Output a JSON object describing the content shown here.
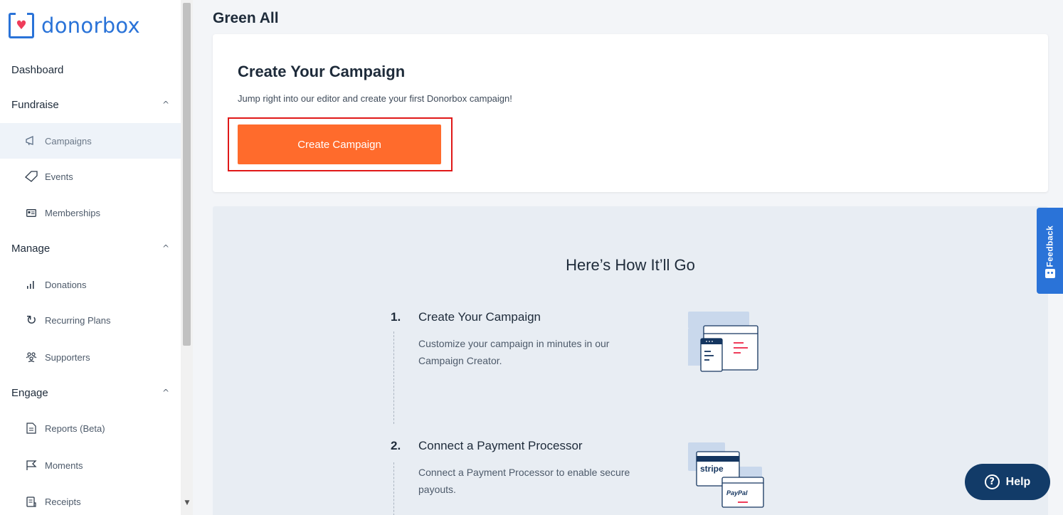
{
  "brand": {
    "name": "donorbox",
    "primary": "#2a73d8",
    "heart": "#ef3c5a"
  },
  "sidebar": {
    "dashboard": "Dashboard",
    "sections": [
      {
        "label": "Fundraise",
        "chevron": "chevron-up-icon"
      },
      {
        "label": "Manage",
        "chevron": "chevron-up-icon"
      },
      {
        "label": "Engage",
        "chevron": "chevron-up-icon"
      }
    ],
    "items": [
      {
        "label": "Campaigns",
        "icon": "megaphone-icon",
        "active": true
      },
      {
        "label": "Events",
        "icon": "ticket-icon"
      },
      {
        "label": "Memberships",
        "icon": "id-card-icon"
      },
      {
        "label": "Donations",
        "icon": "bar-chart-icon"
      },
      {
        "label": "Recurring Plans",
        "icon": "refresh-icon"
      },
      {
        "label": "Supporters",
        "icon": "people-icon"
      },
      {
        "label": "Reports (Beta)",
        "icon": "document-icon"
      },
      {
        "label": "Moments",
        "icon": "flag-icon"
      },
      {
        "label": "Receipts",
        "icon": "receipt-icon"
      }
    ]
  },
  "main": {
    "org_title": "Green All",
    "create_card": {
      "title": "Create Your Campaign",
      "subtitle": "Jump right into our editor and create your first Donorbox campaign!",
      "button_label": "Create Campaign",
      "button_color": "#ff6b2c",
      "highlight_color": "#e01818"
    },
    "how": {
      "title": "Here’s How It’ll Go",
      "steps": [
        {
          "num": "1.",
          "title": "Create Your Campaign",
          "desc": "Customize your campaign in minutes in our Campaign Creator."
        },
        {
          "num": "2.",
          "title": "Connect a Payment Processor",
          "desc": "Connect a Payment Processor to enable secure payouts."
        }
      ],
      "logos": {
        "stripe": "stripe",
        "paypal": "PayPal"
      }
    }
  },
  "feedback": {
    "label": "Feedback"
  },
  "help": {
    "label": "Help"
  }
}
